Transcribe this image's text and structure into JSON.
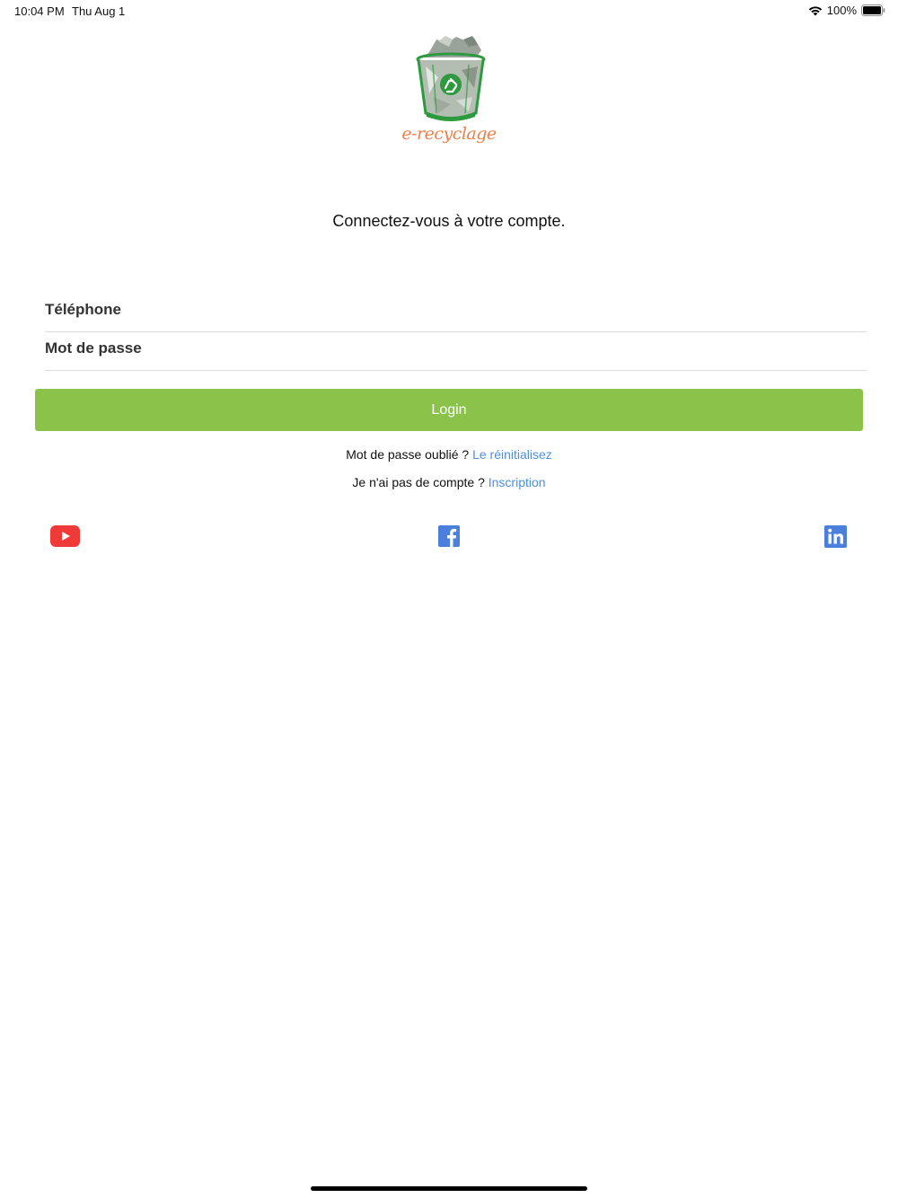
{
  "status_bar": {
    "time": "10:04 PM",
    "date": "Thu Aug 1",
    "battery": "100%"
  },
  "logo": {
    "text": "e-recyclage",
    "icon": "recycle-bin-icon"
  },
  "title": "Connectez-vous à votre compte.",
  "form": {
    "phone_label": "Téléphone",
    "password_label": "Mot de passe",
    "login_label": "Login"
  },
  "help": {
    "forgot_text": "Mot de passe oublié ? ",
    "forgot_link": "Le réinitialisez",
    "signup_text": "Je n'ai pas de compte ? ",
    "signup_link": "Inscription"
  },
  "social": [
    {
      "icon": "youtube-icon"
    },
    {
      "icon": "facebook-icon"
    },
    {
      "icon": "linkedin-icon"
    }
  ],
  "colors": {
    "accent": "#8bc34a",
    "link": "#4a90e2",
    "logo_text": "#ee7f4b",
    "youtube": "#f03a3a",
    "facebook": "#4a7fdc",
    "linkedin": "#4a7fdc"
  }
}
